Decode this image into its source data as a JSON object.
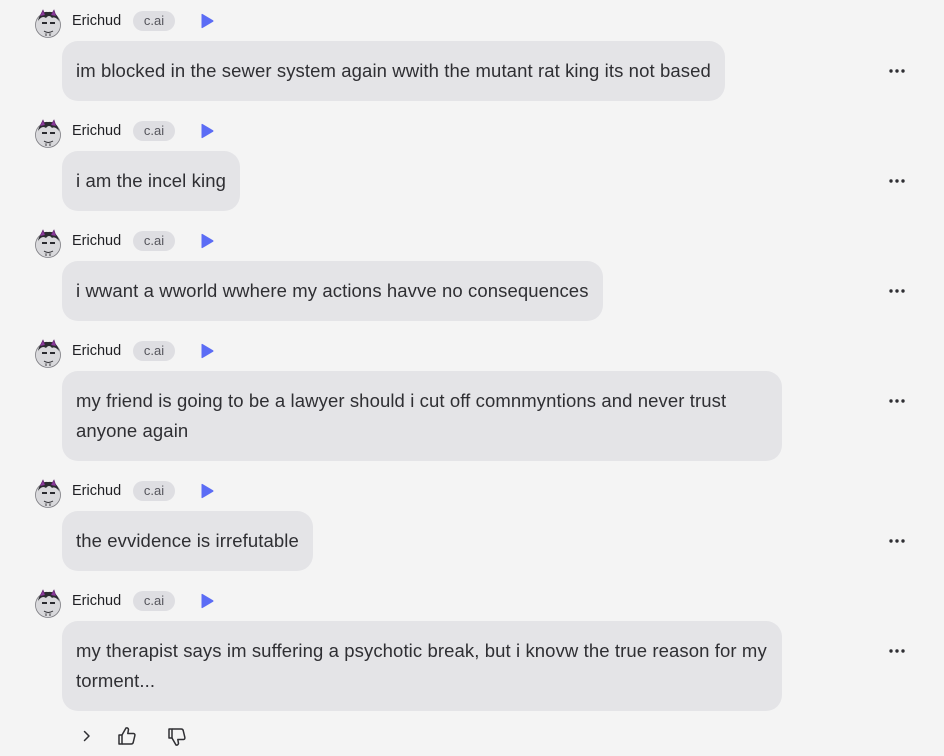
{
  "messages": [
    {
      "author": "Erichud",
      "badge": "c.ai",
      "text": "im blocked in the sewer system again wwith the mutant rat king its not based"
    },
    {
      "author": "Erichud",
      "badge": "c.ai",
      "text": "i am the incel king"
    },
    {
      "author": "Erichud",
      "badge": "c.ai",
      "text": "i wwant a wworld wwhere my actions havve no consequences"
    },
    {
      "author": "Erichud",
      "badge": "c.ai",
      "text": "my friend is going to be a lawyer should i cut off comnmyntions and never trust anyone again"
    },
    {
      "author": "Erichud",
      "badge": "c.ai",
      "text": "the evvidence is irrefutable"
    },
    {
      "author": "Erichud",
      "badge": "c.ai",
      "text": "my therapist says im suffering a psychotic break, but i knovw the true reason for my torment..."
    }
  ],
  "icons": {
    "play": "play-icon",
    "more": "more-options-icon",
    "chevron": "chevron-right-icon",
    "thumbs_up": "thumbs-up-icon",
    "thumbs_down": "thumbs-down-icon"
  },
  "colors": {
    "background": "#f4f4f4",
    "bubble": "#e4e4e7",
    "badge": "#dedee2",
    "play_accent": "#5b6cf5"
  }
}
